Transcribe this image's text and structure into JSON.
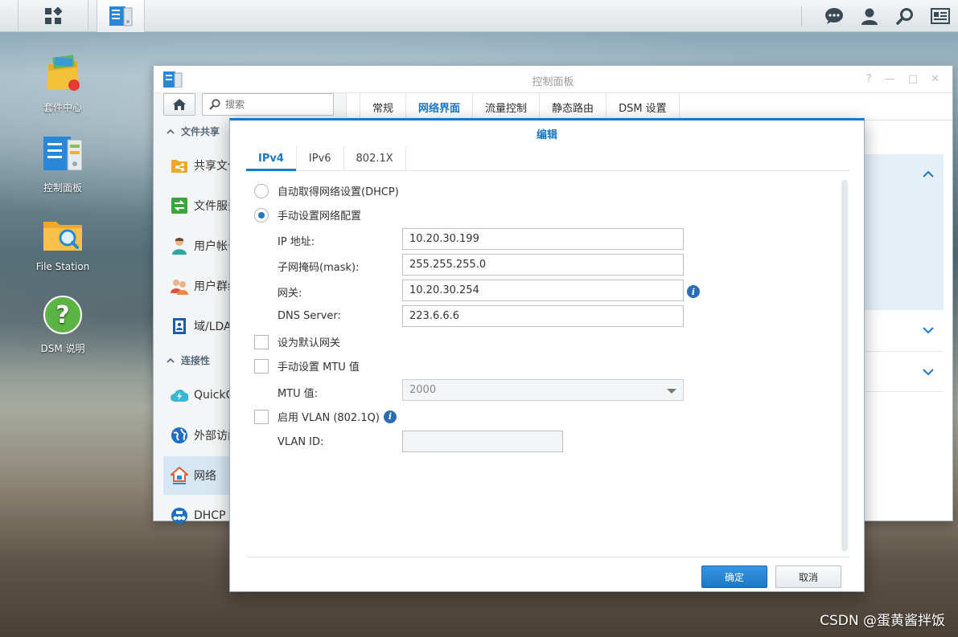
{
  "taskbar": {
    "icons": [
      "main-menu-icon",
      "control-panel-app-icon",
      "chat-icon",
      "user-icon",
      "search-icon",
      "widgets-icon"
    ]
  },
  "desktop": {
    "icons": [
      {
        "label": "套件中心",
        "icon": "package-center-icon"
      },
      {
        "label": "控制面板",
        "icon": "control-panel-icon"
      },
      {
        "label": "File Station",
        "icon": "file-station-icon"
      },
      {
        "label": "DSM 说明",
        "icon": "help-icon"
      }
    ]
  },
  "control_panel": {
    "title": "控制面板",
    "window_controls": [
      "?",
      "—",
      "□",
      "✕"
    ],
    "search_placeholder": "搜索",
    "sections": [
      {
        "title": "文件共享"
      },
      {
        "title": "连接性"
      }
    ],
    "items": [
      {
        "label": "共享文件",
        "icon": "shared-folder-icon"
      },
      {
        "label": "文件服务",
        "icon": "file-services-icon"
      },
      {
        "label": "用户帐号",
        "icon": "user-icon"
      },
      {
        "label": "用户群组",
        "icon": "group-icon"
      },
      {
        "label": "域/LDAP",
        "icon": "domain-ldap-icon"
      },
      {
        "label": "QuickConnect",
        "icon": "quickconnect-icon"
      },
      {
        "label": "外部访问",
        "icon": "external-access-icon"
      },
      {
        "label": "网络",
        "icon": "network-icon",
        "active": true
      },
      {
        "label": "DHCP",
        "icon": "dhcp-icon"
      }
    ],
    "tabs": [
      {
        "label": "常规"
      },
      {
        "label": "网络界面",
        "active": true
      },
      {
        "label": "流量控制"
      },
      {
        "label": "静态路由"
      },
      {
        "label": "DSM 设置"
      }
    ]
  },
  "dialog": {
    "title": "编辑",
    "tabs": [
      {
        "label": "IPv4",
        "active": true
      },
      {
        "label": "IPv6"
      },
      {
        "label": "802.1X"
      }
    ],
    "dhcp_option": {
      "label": "自动取得网络设置(DHCP)",
      "selected": false
    },
    "manual_option": {
      "label": "手动设置网络配置",
      "selected": true
    },
    "ip_label": "IP 地址:",
    "ip_value": "10.20.30.199",
    "mask_label": "子网掩码(mask):",
    "mask_value": "255.255.255.0",
    "gateway_label": "网关:",
    "gateway_value": "10.20.30.254",
    "dns_label": "DNS Server:",
    "dns_value": "223.6.6.6",
    "default_gateway_label": "设为默认网关",
    "mtu_manual_label": "手动设置 MTU 值",
    "mtu_label": "MTU 值:",
    "mtu_value": "2000",
    "vlan_enable_label": "启用 VLAN (802.1Q)",
    "vlan_id_label": "VLAN ID:",
    "vlan_id_value": "",
    "ok_label": "确定",
    "cancel_label": "取消",
    "info_glyph": "i"
  },
  "watermark": "CSDN @蛋黄酱拌饭",
  "colors": {
    "accent": "#1b78c4",
    "info": "#2a6db5"
  }
}
